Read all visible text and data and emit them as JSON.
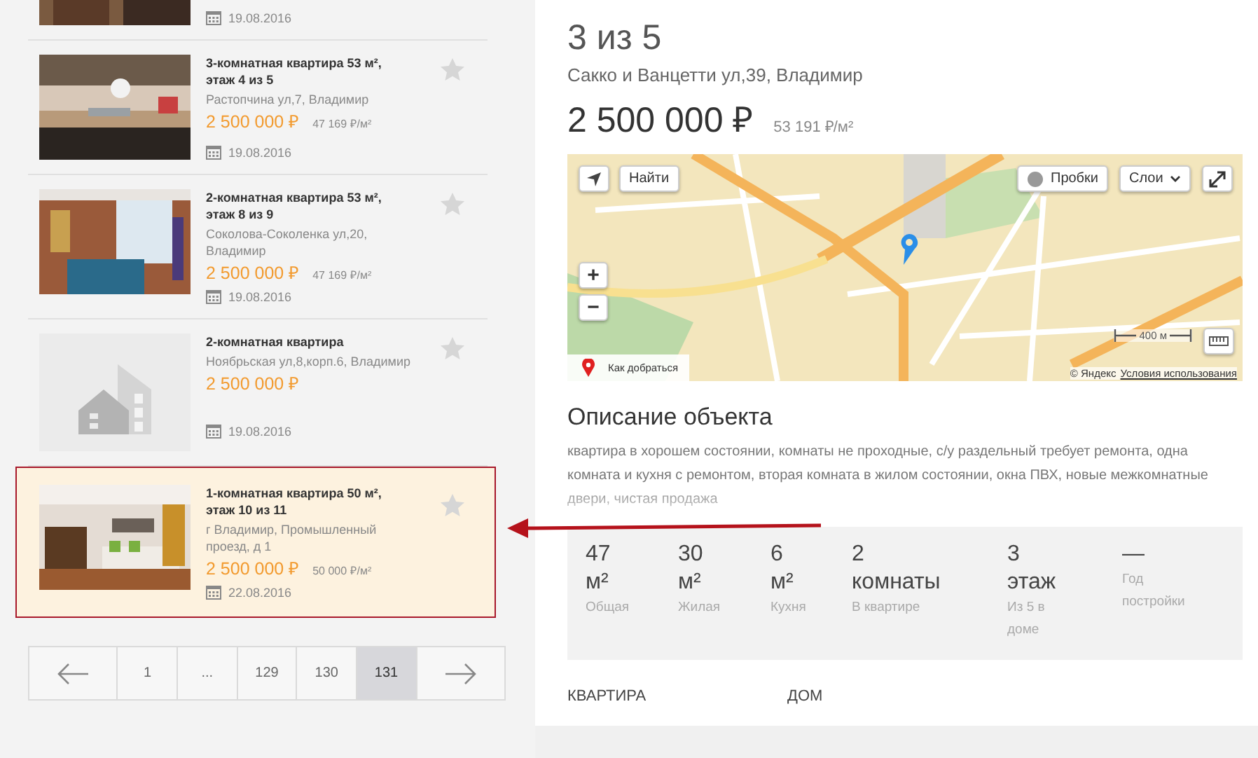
{
  "listings": [
    {
      "date": "19.08.2016"
    },
    {
      "title": "3-комнатная квартира 53 м²,\nэтаж 4 из 5",
      "address": "Растопчина ул,7, Владимир",
      "price": "2 500 000 ₽",
      "price_per_m2": "47 169 ₽/м²",
      "date": "19.08.2016",
      "favorite": false,
      "selected": false
    },
    {
      "title": "2-комнатная квартира 53 м²,\nэтаж 8 из 9",
      "address": "Соколова-Соколенка ул,20,\nВладимир",
      "price": "2 500 000 ₽",
      "price_per_m2": "47 169 ₽/м²",
      "date": "19.08.2016",
      "favorite": false,
      "selected": false
    },
    {
      "kind": "placeholder",
      "title": "2-комнатная квартира",
      "address": "Ноябрьская ул,8,корп.6, Владимир",
      "price": "2 500 000 ₽",
      "date": "19.08.2016",
      "favorite": false,
      "selected": false
    },
    {
      "title": "1-комнатная квартира 50 м²,\nэтаж 10 из 11",
      "address": "г Владимир, Промышленный\nпроезд, д 1",
      "price": "2 500 000 ₽",
      "price_per_m2": "50 000 ₽/м²",
      "date": "22.08.2016",
      "favorite": false,
      "selected": true
    }
  ],
  "pagination": [
    {
      "kind": "prev",
      "selected": false
    },
    {
      "kind": "page",
      "label": "1",
      "selected": false
    },
    {
      "kind": "page",
      "label": "...",
      "selected": false
    },
    {
      "kind": "page",
      "label": "129",
      "selected": false
    },
    {
      "kind": "page",
      "label": "130",
      "selected": false
    },
    {
      "kind": "page",
      "label": "131",
      "selected": true
    },
    {
      "kind": "next",
      "selected": false
    }
  ],
  "detail": {
    "counter": "3 из 5",
    "address": "Сакко и Ванцетти ул,39, Владимир",
    "price": "2 500 000 ₽",
    "price_per_m2": "53 191 ₽/м²",
    "map": {
      "find_button": "Найти",
      "traffic_button": "Пробки",
      "layers_button": "Слои",
      "zoom_in": "+",
      "zoom_out": "−",
      "route_link": "Как добраться",
      "scale": "400 м",
      "copyright": "© Яндекс",
      "terms_link": "Условия использования"
    },
    "description_title": "Описание объекта",
    "description": "квартира в хорошем состоянии, комнаты не проходные, с/у раздельный требует ремонта, одна комната и кухня с ремонтом, вторая комната в жилом состоянии, окна ПВХ, новые межкомнатные двери, чистая продажа",
    "stats": [
      {
        "value": "47",
        "unit": "м²",
        "label": "Общая"
      },
      {
        "value": "30",
        "unit": "м²",
        "label": "Жилая"
      },
      {
        "value": "6",
        "unit": "м²",
        "label": "Кухня"
      },
      {
        "value": "2",
        "unit": "комнаты",
        "label": "В квартире"
      },
      {
        "value": "3",
        "unit": "этаж",
        "label": "Из 5 в доме"
      },
      {
        "value": "—",
        "label": "Год постройки"
      }
    ],
    "tabs": [
      "КВАРТИРА",
      "ДОМ"
    ]
  }
}
